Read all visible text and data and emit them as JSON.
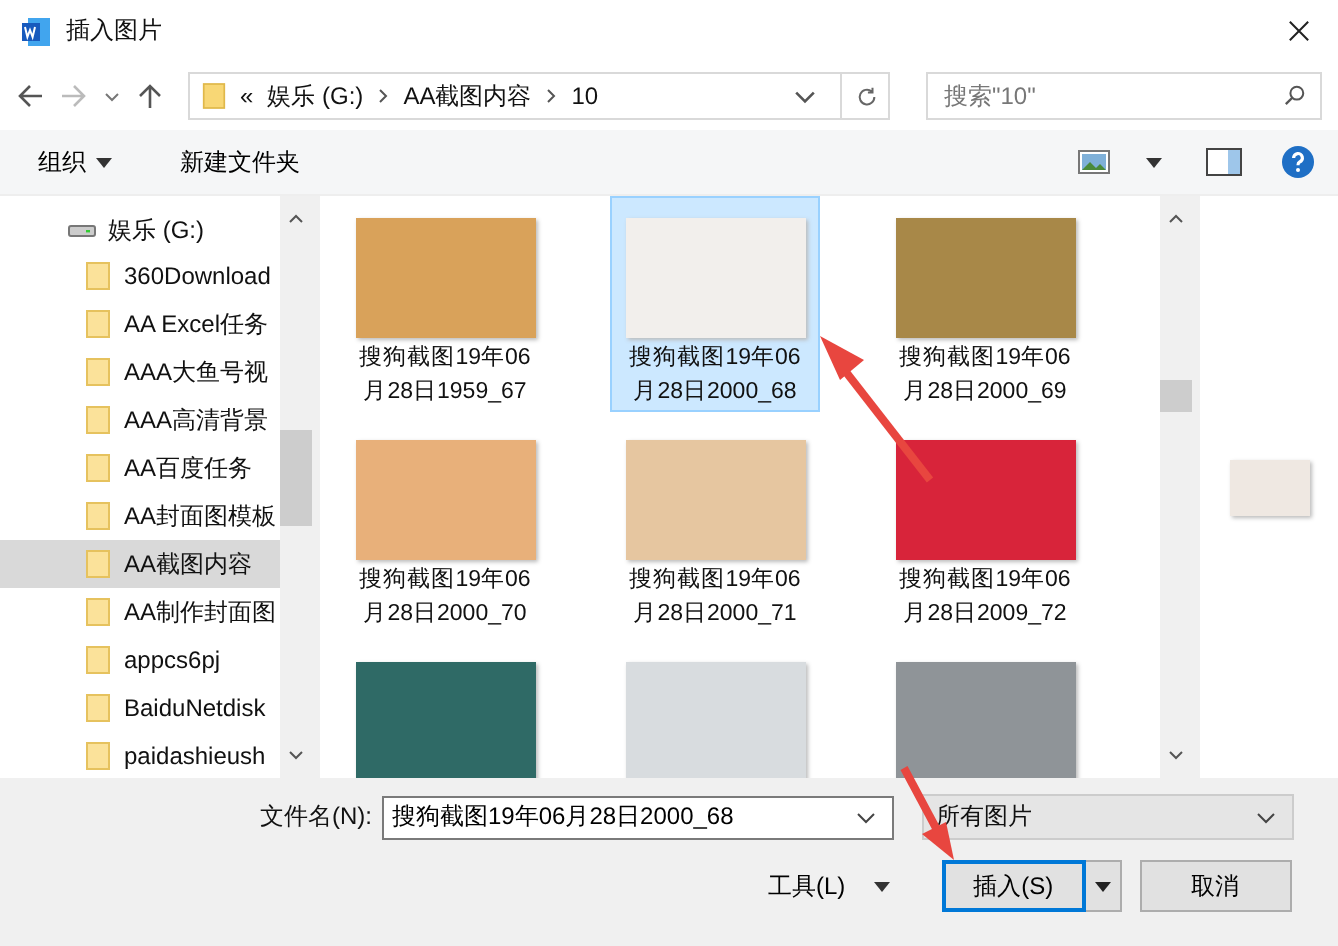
{
  "window": {
    "title": "插入图片"
  },
  "address": {
    "prefix": "«",
    "segments": [
      "娱乐 (G:)",
      "AA截图内容",
      "10"
    ]
  },
  "search": {
    "placeholder": "搜索\"10\""
  },
  "toolbar": {
    "organize": "组织",
    "new_folder": "新建文件夹"
  },
  "sidebar": {
    "drive": "娱乐 (G:)",
    "items": [
      {
        "label": "360Download",
        "selected": false
      },
      {
        "label": "AA Excel任务",
        "selected": false
      },
      {
        "label": "AAA大鱼号视",
        "selected": false
      },
      {
        "label": "AAA高清背景",
        "selected": false
      },
      {
        "label": "AA百度任务",
        "selected": false
      },
      {
        "label": "AA封面图模板",
        "selected": false
      },
      {
        "label": "AA截图内容",
        "selected": true
      },
      {
        "label": "AA制作封面图",
        "selected": false
      },
      {
        "label": "appcs6pj",
        "selected": false
      },
      {
        "label": "BaiduNetdisk",
        "selected": false
      },
      {
        "label": "paidashieush",
        "selected": false
      }
    ]
  },
  "files": [
    {
      "lines": [
        "搜狗截图19年06",
        "月28日1959_67"
      ],
      "selected": false
    },
    {
      "lines": [
        "搜狗截图19年06",
        "月28日2000_68"
      ],
      "selected": true
    },
    {
      "lines": [
        "搜狗截图19年06",
        "月28日2000_69"
      ],
      "selected": false
    },
    {
      "lines": [
        "搜狗截图19年06",
        "月28日2000_70"
      ],
      "selected": false
    },
    {
      "lines": [
        "搜狗截图19年06",
        "月28日2000_71"
      ],
      "selected": false
    },
    {
      "lines": [
        "搜狗截图19年06",
        "月28日2009_72"
      ],
      "selected": false
    },
    {
      "selected": false
    },
    {
      "selected": false
    },
    {
      "selected": false
    }
  ],
  "bottom": {
    "filename_label": "文件名(N):",
    "filename": "搜狗截图19年06月28日2000_68",
    "filetype": "所有图片",
    "tools": "工具(L)",
    "insert": "插入(S)",
    "cancel": "取消"
  }
}
